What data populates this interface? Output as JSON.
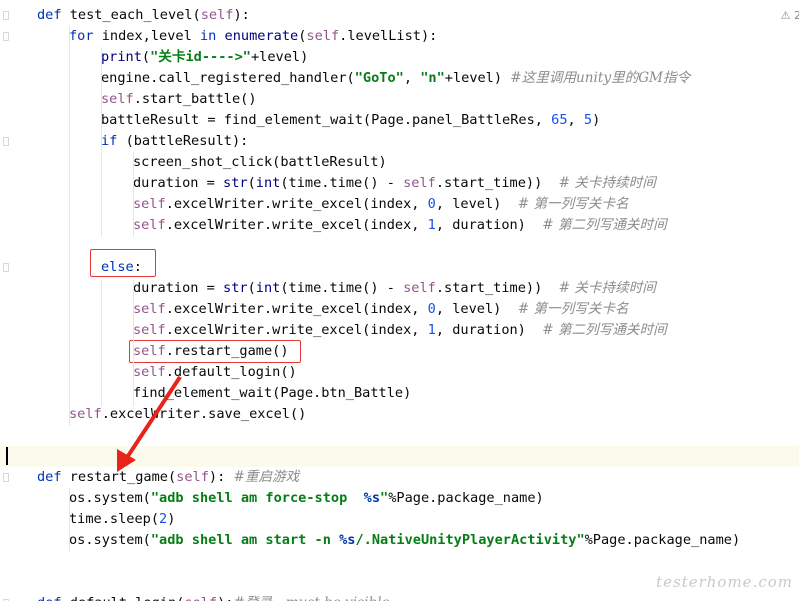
{
  "editor": {
    "warning_badge": "⚠ 2",
    "watermark": "testerhome.com",
    "lines": [
      {
        "tokens": [
          {
            "t": "kw",
            "v": "def "
          },
          {
            "t": "plain",
            "v": "test_each_level("
          },
          {
            "t": "self",
            "v": "self"
          },
          {
            "t": "plain",
            "v": "):"
          }
        ]
      },
      {
        "tokens": [
          {
            "t": "kw",
            "v": "for "
          },
          {
            "t": "plain",
            "v": "index,level "
          },
          {
            "t": "kw",
            "v": "in "
          },
          {
            "t": "fn",
            "v": "enumerate"
          },
          {
            "t": "plain",
            "v": "("
          },
          {
            "t": "self",
            "v": "self"
          },
          {
            "t": "plain",
            "v": ".levelList):"
          }
        ]
      },
      {
        "tokens": [
          {
            "t": "fn",
            "v": "print"
          },
          {
            "t": "plain",
            "v": "("
          },
          {
            "t": "str",
            "v": "\"关卡id---->\""
          },
          {
            "t": "plain",
            "v": "+level)"
          }
        ]
      },
      {
        "tokens": [
          {
            "t": "plain",
            "v": "engine.call_registered_handler("
          },
          {
            "t": "str",
            "v": "\"GoTo\""
          },
          {
            "t": "plain",
            "v": ", "
          },
          {
            "t": "str",
            "v": "\"n\""
          },
          {
            "t": "plain",
            "v": "+level) "
          },
          {
            "t": "cmt",
            "v": "#这里调用unity里的GM指令"
          }
        ]
      },
      {
        "tokens": [
          {
            "t": "self",
            "v": "self"
          },
          {
            "t": "plain",
            "v": ".start_battle()"
          }
        ]
      },
      {
        "tokens": [
          {
            "t": "plain",
            "v": "battleResult = find_element_wait(Page.panel_BattleRes, "
          },
          {
            "t": "num",
            "v": "65"
          },
          {
            "t": "plain",
            "v": ", "
          },
          {
            "t": "num",
            "v": "5"
          },
          {
            "t": "plain",
            "v": ")"
          }
        ]
      },
      {
        "tokens": [
          {
            "t": "kw",
            "v": "if "
          },
          {
            "t": "plain",
            "v": "(battleResult):"
          }
        ]
      },
      {
        "tokens": [
          {
            "t": "plain",
            "v": "screen_shot_click(battleResult)"
          }
        ]
      },
      {
        "tokens": [
          {
            "t": "plain",
            "v": "duration = "
          },
          {
            "t": "fn",
            "v": "str"
          },
          {
            "t": "plain",
            "v": "("
          },
          {
            "t": "fn",
            "v": "int"
          },
          {
            "t": "plain",
            "v": "(time.time() - "
          },
          {
            "t": "self",
            "v": "self"
          },
          {
            "t": "plain",
            "v": ".start_time))  "
          },
          {
            "t": "cmt",
            "v": "# 关卡持续时间"
          }
        ]
      },
      {
        "tokens": [
          {
            "t": "self",
            "v": "self"
          },
          {
            "t": "plain",
            "v": ".excelWriter.write_excel(index, "
          },
          {
            "t": "num",
            "v": "0"
          },
          {
            "t": "plain",
            "v": ", level)  "
          },
          {
            "t": "cmt",
            "v": "# 第一列写关卡名"
          }
        ]
      },
      {
        "tokens": [
          {
            "t": "self",
            "v": "self"
          },
          {
            "t": "plain",
            "v": ".excelWriter.write_excel(index, "
          },
          {
            "t": "num",
            "v": "1"
          },
          {
            "t": "plain",
            "v": ", duration)  "
          },
          {
            "t": "cmt",
            "v": "# 第二列写通关时间"
          }
        ]
      },
      {
        "tokens": []
      },
      {
        "tokens": [
          {
            "t": "kw",
            "v": "else"
          },
          {
            "t": "plain",
            "v": ":"
          }
        ]
      },
      {
        "tokens": [
          {
            "t": "plain",
            "v": "duration = "
          },
          {
            "t": "fn",
            "v": "str"
          },
          {
            "t": "plain",
            "v": "("
          },
          {
            "t": "fn",
            "v": "int"
          },
          {
            "t": "plain",
            "v": "(time.time() - "
          },
          {
            "t": "self",
            "v": "self"
          },
          {
            "t": "plain",
            "v": ".start_time))  "
          },
          {
            "t": "cmt",
            "v": "# 关卡持续时间"
          }
        ]
      },
      {
        "tokens": [
          {
            "t": "self",
            "v": "self"
          },
          {
            "t": "plain",
            "v": ".excelWriter.write_excel(index, "
          },
          {
            "t": "num",
            "v": "0"
          },
          {
            "t": "plain",
            "v": ", level)  "
          },
          {
            "t": "cmt",
            "v": "# 第一列写关卡名"
          }
        ]
      },
      {
        "tokens": [
          {
            "t": "self",
            "v": "self"
          },
          {
            "t": "plain",
            "v": ".excelWriter.write_excel(index, "
          },
          {
            "t": "num",
            "v": "1"
          },
          {
            "t": "plain",
            "v": ", duration)  "
          },
          {
            "t": "cmt",
            "v": "# 第二列写通关时间"
          }
        ]
      },
      {
        "tokens": [
          {
            "t": "self",
            "v": "self"
          },
          {
            "t": "plain",
            "v": ".restart_game()"
          }
        ]
      },
      {
        "tokens": [
          {
            "t": "self",
            "v": "self"
          },
          {
            "t": "plain",
            "v": ".default_login()"
          }
        ]
      },
      {
        "tokens": [
          {
            "t": "plain",
            "v": "find_element_wait(Page.btn_Battle)"
          }
        ]
      },
      {
        "tokens": [
          {
            "t": "self",
            "v": "self"
          },
          {
            "t": "plain",
            "v": ".excelWriter.save_excel()"
          }
        ]
      },
      {
        "tokens": []
      },
      {
        "tokens": []
      },
      {
        "tokens": [
          {
            "t": "kw",
            "v": "def "
          },
          {
            "t": "plain",
            "v": "restart_game("
          },
          {
            "t": "self",
            "v": "self"
          },
          {
            "t": "plain",
            "v": "): "
          },
          {
            "t": "cmt",
            "v": "#重启游戏"
          }
        ]
      },
      {
        "tokens": [
          {
            "t": "plain",
            "v": "os.system("
          },
          {
            "t": "str",
            "v": "\"adb shell am force-stop  "
          },
          {
            "t": "fmt",
            "v": "%s"
          },
          {
            "t": "str",
            "v": "\""
          },
          {
            "t": "plain",
            "v": "%Page.package_name)"
          }
        ]
      },
      {
        "tokens": [
          {
            "t": "plain",
            "v": "time.sleep("
          },
          {
            "t": "num",
            "v": "2"
          },
          {
            "t": "plain",
            "v": ")"
          }
        ]
      },
      {
        "tokens": [
          {
            "t": "plain",
            "v": "os.system("
          },
          {
            "t": "str",
            "v": "\"adb shell am start -n "
          },
          {
            "t": "fmt",
            "v": "%s"
          },
          {
            "t": "str",
            "v": "/.NativeUnityPlayerActivity\""
          },
          {
            "t": "plain",
            "v": "%Page.package_name)"
          }
        ]
      },
      {
        "tokens": []
      },
      {
        "tokens": []
      },
      {
        "tokens": [
          {
            "t": "kw",
            "v": "def "
          },
          {
            "t": "plain",
            "v": "default_login("
          },
          {
            "t": "self",
            "v": "self"
          },
          {
            "t": "plain",
            "v": "):"
          },
          {
            "t": "cmt",
            "v": "#登录，must be visible"
          }
        ]
      }
    ]
  }
}
